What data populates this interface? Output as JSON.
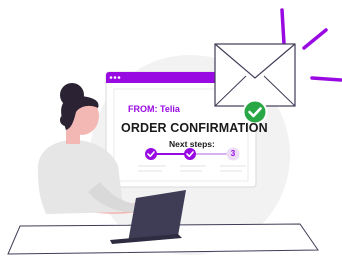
{
  "email_window": {
    "from_label": "FROM: Telia",
    "title": "ORDER CONFIRMATION",
    "next_steps_label": "Next steps:",
    "steps": [
      {
        "label": "",
        "state": "done"
      },
      {
        "label": "",
        "state": "done"
      },
      {
        "label": "3",
        "state": "pending"
      }
    ]
  },
  "colors": {
    "brand_purple": "#990ae3",
    "success_green": "#29a745",
    "hair": "#2b2233",
    "skin": "#f4b8b4",
    "laptop": "#3f3d56"
  },
  "icons": [
    "envelope-icon",
    "check-badge-icon",
    "checkmark-icon"
  ]
}
